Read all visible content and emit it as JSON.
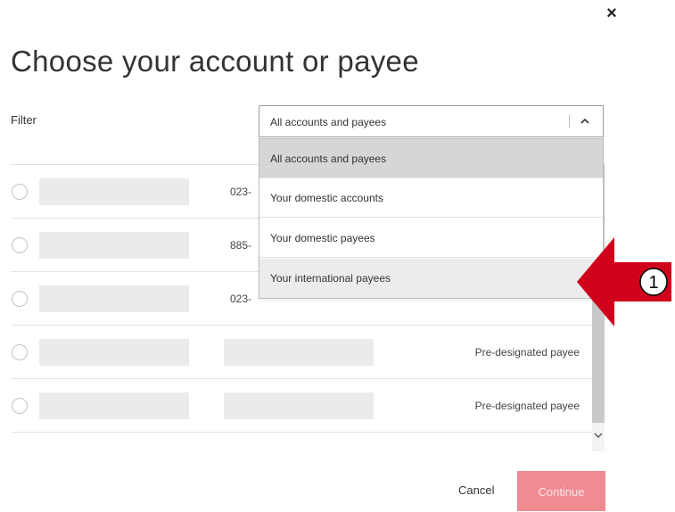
{
  "modal": {
    "close_glyph": "×",
    "title": "Choose your account or payee"
  },
  "filter": {
    "label": "Filter",
    "selected_value": "All accounts and payees",
    "options": [
      "All accounts and payees",
      "Your domestic accounts",
      "Your domestic payees",
      "Your international payees"
    ]
  },
  "rows": [
    {
      "account": "023-",
      "type": ""
    },
    {
      "account": "885-",
      "type": ""
    },
    {
      "account": "023-",
      "type": ""
    },
    {
      "account": "",
      "type": "Pre-designated payee"
    },
    {
      "account": "",
      "type": "Pre-designated payee"
    }
  ],
  "footer": {
    "cancel_label": "Cancel",
    "continue_label": "Continue"
  },
  "callout": {
    "number": "1",
    "arrow_color": "#d0021b"
  },
  "colors": {
    "accent": "#f08b92",
    "selected_option": "#d6d6d6",
    "hover_option": "#ececec"
  }
}
